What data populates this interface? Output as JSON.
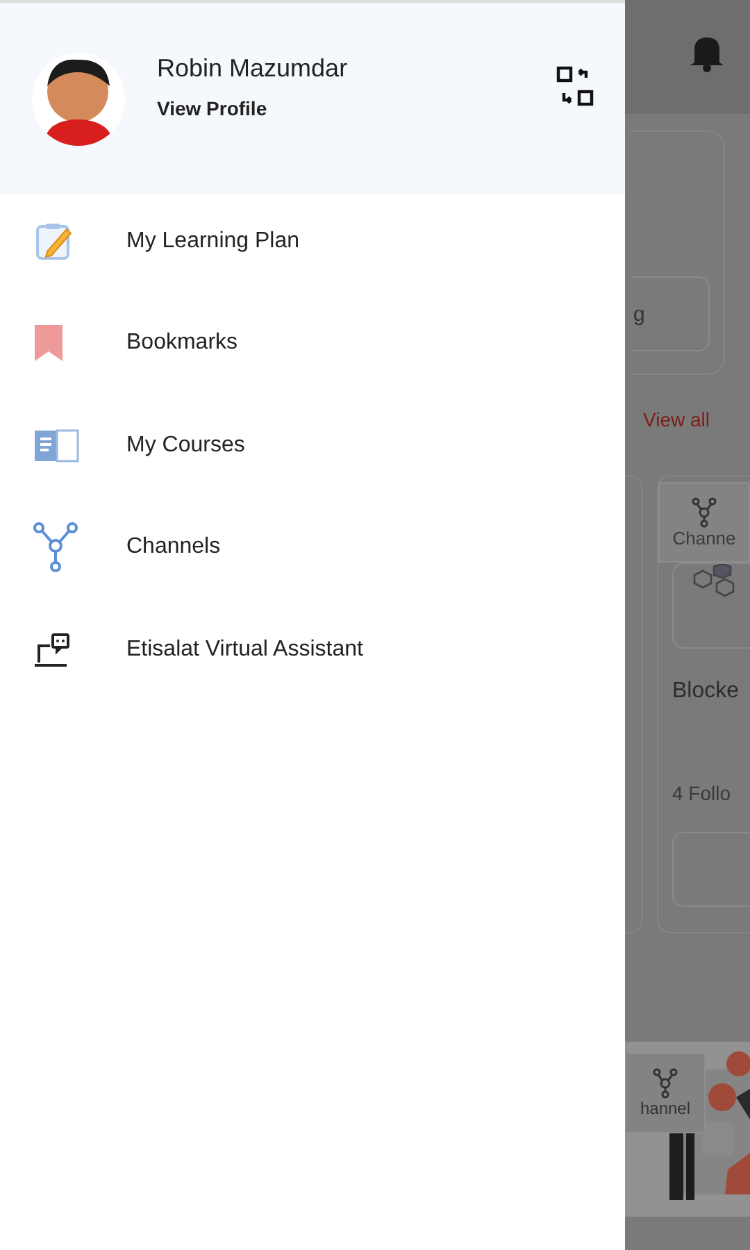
{
  "drawer": {
    "profile": {
      "name": "Robin Mazumdar",
      "link": "View Profile"
    },
    "menu": [
      {
        "label": "My Learning Plan",
        "kind": "plan"
      },
      {
        "label": "Bookmarks",
        "kind": "bookmark"
      },
      {
        "label": "My Courses",
        "kind": "book"
      },
      {
        "label": "Channels",
        "kind": "channels"
      },
      {
        "label": "Etisalat Virtual Assistant",
        "kind": "assistant"
      }
    ]
  },
  "background": {
    "search_text": "g",
    "view_all": "View all",
    "card": {
      "tag": "Channe",
      "title": "Blocke",
      "followers": "4 Follo"
    },
    "banner": {
      "tag": "hannel",
      "kind": "picture"
    }
  }
}
